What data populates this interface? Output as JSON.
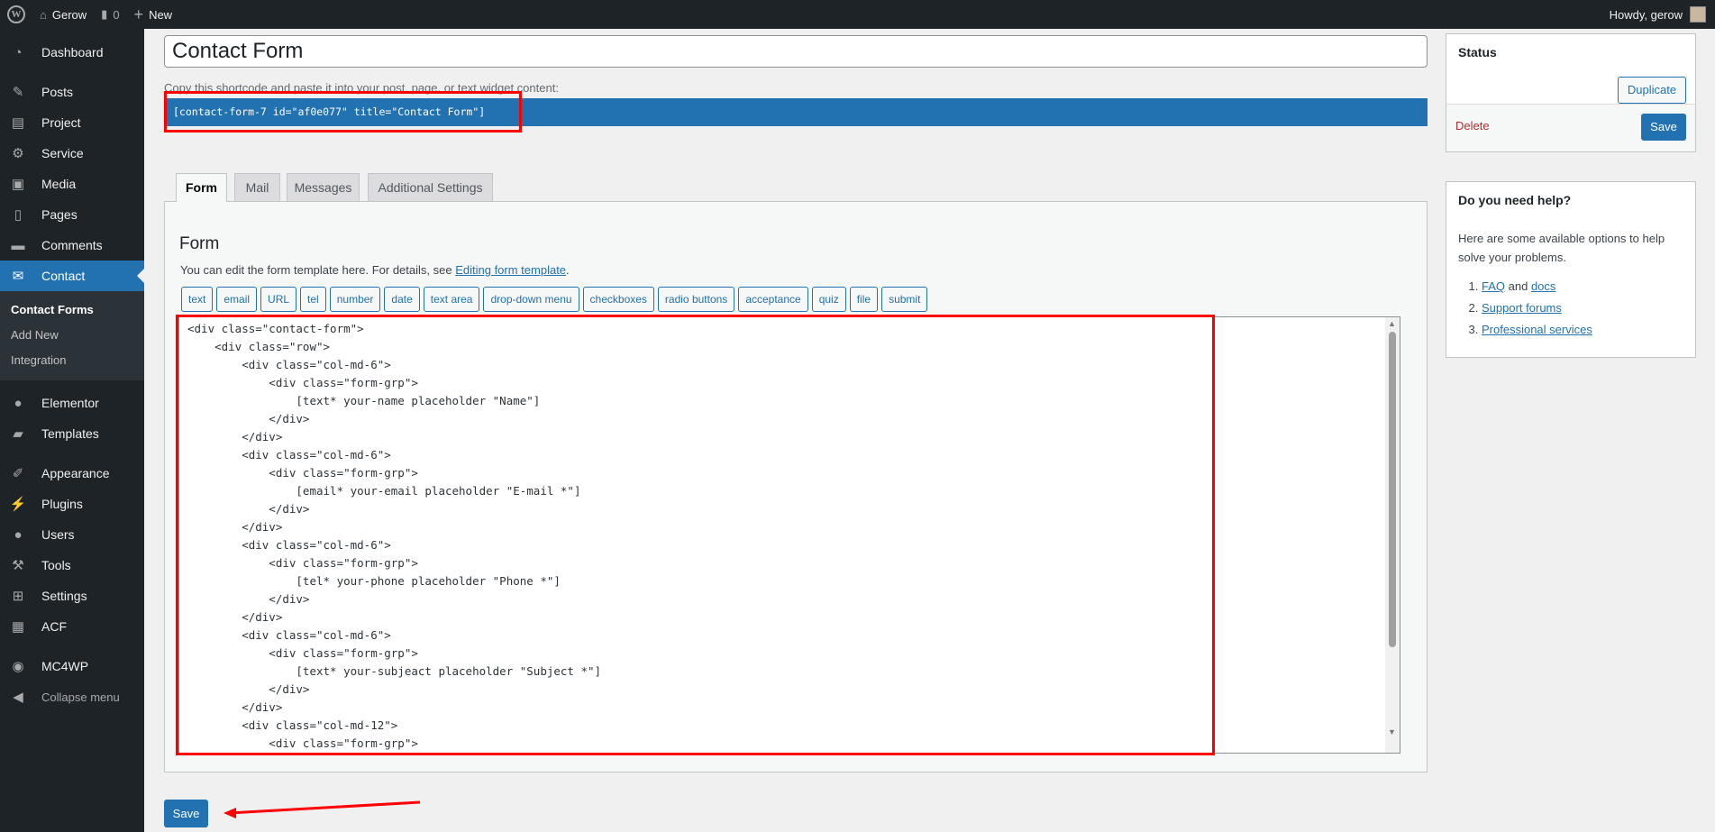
{
  "adminbar": {
    "site": "Gerow",
    "comments": "0",
    "new": "New",
    "howdy": "Howdy, gerow"
  },
  "sidebar": {
    "items": [
      {
        "label": "Dashboard",
        "icon": "dashboard-icon"
      },
      {
        "label": "Posts",
        "icon": "pin-icon"
      },
      {
        "label": "Project",
        "icon": "project-icon"
      },
      {
        "label": "Service",
        "icon": "gear-icon"
      },
      {
        "label": "Media",
        "icon": "media-icon"
      },
      {
        "label": "Pages",
        "icon": "pages-icon"
      },
      {
        "label": "Comments",
        "icon": "comment-icon"
      },
      {
        "label": "Contact",
        "icon": "envelope-icon"
      },
      {
        "label": "Elementor",
        "icon": "elementor-icon"
      },
      {
        "label": "Templates",
        "icon": "folder-icon"
      },
      {
        "label": "Appearance",
        "icon": "brush-icon"
      },
      {
        "label": "Plugins",
        "icon": "plug-icon"
      },
      {
        "label": "Users",
        "icon": "user-icon"
      },
      {
        "label": "Tools",
        "icon": "wrench-icon"
      },
      {
        "label": "Settings",
        "icon": "sliders-icon"
      },
      {
        "label": "ACF",
        "icon": "acf-icon"
      },
      {
        "label": "MC4WP",
        "icon": "mc4wp-icon"
      }
    ],
    "submenu": [
      "Contact Forms",
      "Add New",
      "Integration"
    ],
    "collapse": "Collapse menu"
  },
  "main": {
    "title": "Contact Form",
    "copy_text": "Copy this shortcode and paste it into your post, page, or text widget content:",
    "shortcode": "[contact-form-7 id=\"af0e077\" title=\"Contact Form\"]",
    "tabs": [
      "Form",
      "Mail",
      "Messages",
      "Additional Settings"
    ],
    "form_heading": "Form",
    "desc_text": "You can edit the form template here. For details, see ",
    "desc_link": "Editing form template",
    "tags": [
      "text",
      "email",
      "URL",
      "tel",
      "number",
      "date",
      "text area",
      "drop-down menu",
      "checkboxes",
      "radio buttons",
      "acceptance",
      "quiz",
      "file",
      "submit"
    ],
    "code": "<div class=\"contact-form\">\n    <div class=\"row\">\n        <div class=\"col-md-6\">\n            <div class=\"form-grp\">\n                [text* your-name placeholder \"Name\"]\n            </div>\n        </div>\n        <div class=\"col-md-6\">\n            <div class=\"form-grp\">\n                [email* your-email placeholder \"E-mail *\"]\n            </div>\n        </div>\n        <div class=\"col-md-6\">\n            <div class=\"form-grp\">\n                [tel* your-phone placeholder \"Phone *\"]\n            </div>\n        </div>\n        <div class=\"col-md-6\">\n            <div class=\"form-grp\">\n                [text* your-subjeact placeholder \"Subject *\"]\n            </div>\n        </div>\n        <div class=\"col-md-12\">\n            <div class=\"form-grp\">",
    "save": "Save"
  },
  "status": {
    "title": "Status",
    "duplicate": "Duplicate",
    "delete": "Delete",
    "save": "Save"
  },
  "help": {
    "title": "Do you need help?",
    "text": "Here are some available options to help solve your problems.",
    "faq": "FAQ",
    "and": " and ",
    "docs": "docs",
    "forums": "Support forums",
    "services": "Professional services"
  },
  "colors": {
    "accent": "#2271b1",
    "sidebar": "#1d2327",
    "annotation": "#ff0000",
    "delete": "#b32d2e"
  }
}
